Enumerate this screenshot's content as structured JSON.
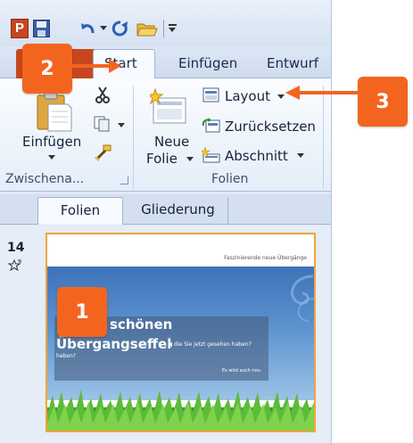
{
  "ribbon": {
    "tabs": [
      {
        "label": "Start"
      },
      {
        "label": "Einfügen"
      },
      {
        "label": "Entwurf"
      }
    ],
    "clipboard": {
      "paste_label": "Einfügen",
      "group_label": "Zwischena..."
    },
    "slides": {
      "new_slide_line1": "Neue",
      "new_slide_line2": "Folie",
      "layout_label": "Layout",
      "reset_label": "Zurücksetzen",
      "section_label": "Abschnitt",
      "group_label": "Folien"
    }
  },
  "panel": {
    "tabs": [
      {
        "label": "Folien"
      },
      {
        "label": "Gliederung"
      }
    ],
    "slide_number": "14",
    "thumbnail": {
      "header_text": "Faszinierende neue Übergänge",
      "title_line1": "schönen",
      "title_line2": "Übergangseffekte,",
      "body_text": "die Sie jetzt gesehen haben?",
      "body_text_cont": "haben?",
      "footer_text": "Es wird auch neu."
    }
  },
  "callouts": [
    {
      "number": "1"
    },
    {
      "number": "2"
    },
    {
      "number": "3"
    }
  ],
  "colors": {
    "callout": "#f3651f",
    "file_tab": "#c8461f",
    "slide_border": "#f0a53a"
  }
}
